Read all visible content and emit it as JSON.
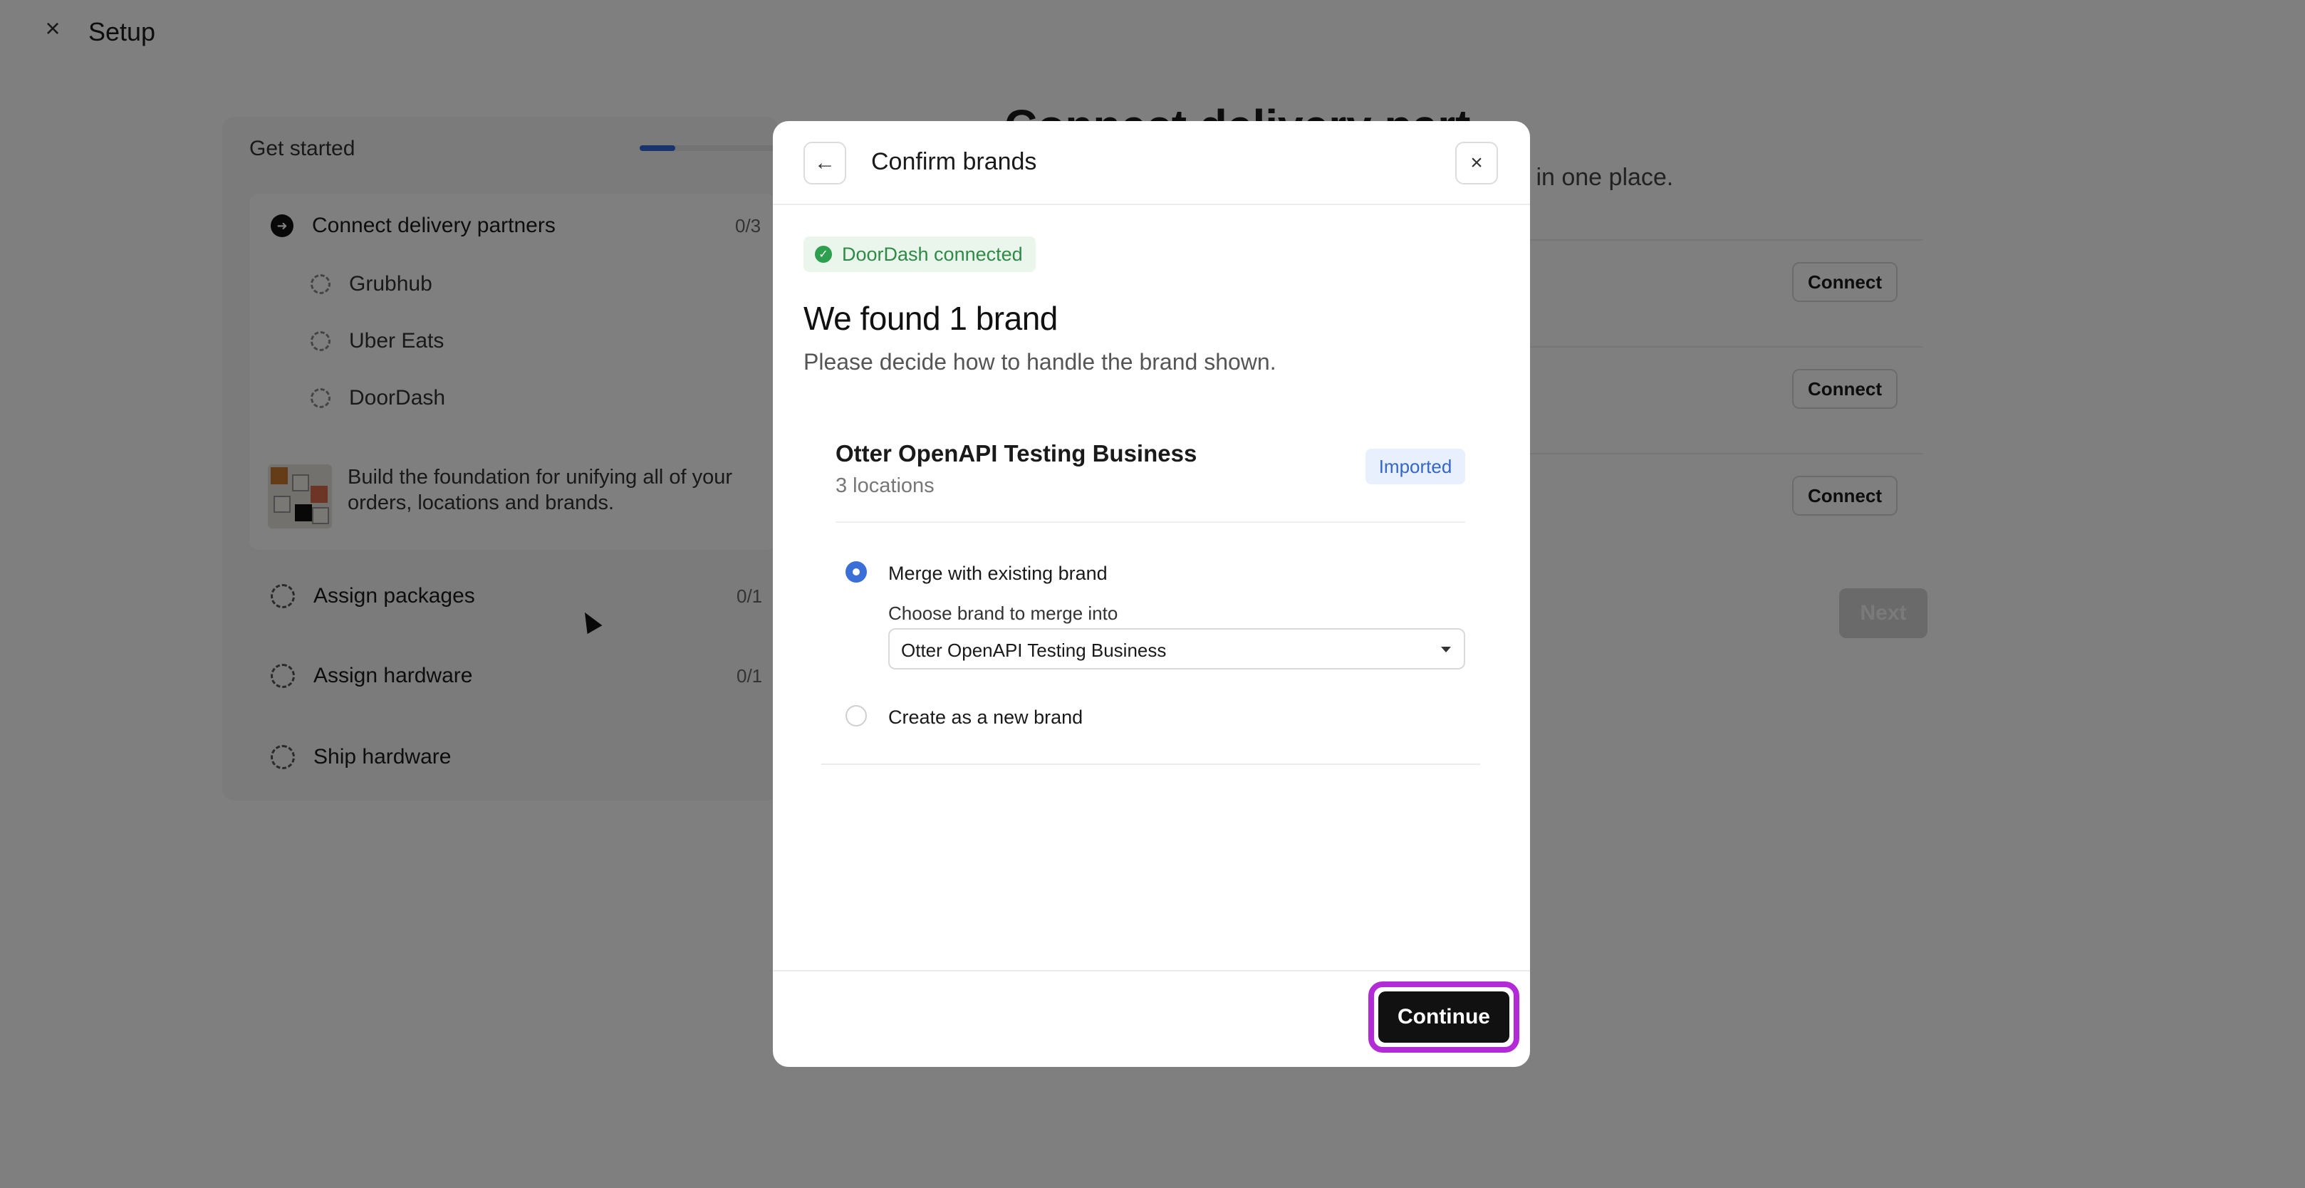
{
  "header": {
    "title": "Setup",
    "close_icon": "close-icon"
  },
  "sidebar": {
    "section_title": "Get started",
    "progress_fraction": 0.25,
    "steps": [
      {
        "label": "Connect delivery partners",
        "count": "0/3",
        "state": "active",
        "subitems": [
          "Grubhub",
          "Uber Eats",
          "DoorDash"
        ],
        "description": "Build the foundation for unifying all of your orders, locations and brands."
      },
      {
        "label": "Assign packages",
        "count": "0/1"
      },
      {
        "label": "Assign hardware",
        "count": "0/1"
      },
      {
        "label": "Ship hardware",
        "count": ""
      }
    ]
  },
  "main": {
    "headline_partial": "Connect delivery part",
    "subtitle_partial": "s in one place.",
    "partners": [
      {
        "connect_label": "Connect"
      },
      {
        "connect_label": "Connect"
      },
      {
        "connect_label": "Connect"
      }
    ],
    "next_label": "Next"
  },
  "modal": {
    "title": "Confirm brands",
    "back_icon": "arrow-left-icon",
    "close_icon": "close-icon",
    "status_badge": "DoorDash connected",
    "heading": "We found 1 brand",
    "subheading": "Please decide how to handle the brand shown.",
    "brand": {
      "name": "Otter OpenAPI Testing Business",
      "locations": "3 locations",
      "tag": "Imported"
    },
    "options": {
      "merge_label": "Merge with existing brand",
      "merge_selected": true,
      "choose_label": "Choose brand to merge into",
      "choose_value": "Otter OpenAPI Testing Business",
      "new_label": "Create as a new brand",
      "new_selected": false
    },
    "continue_label": "Continue",
    "colors": {
      "accent": "#3a6fd8",
      "highlight": "#b32bd6",
      "success": "#2e9e4f"
    }
  }
}
